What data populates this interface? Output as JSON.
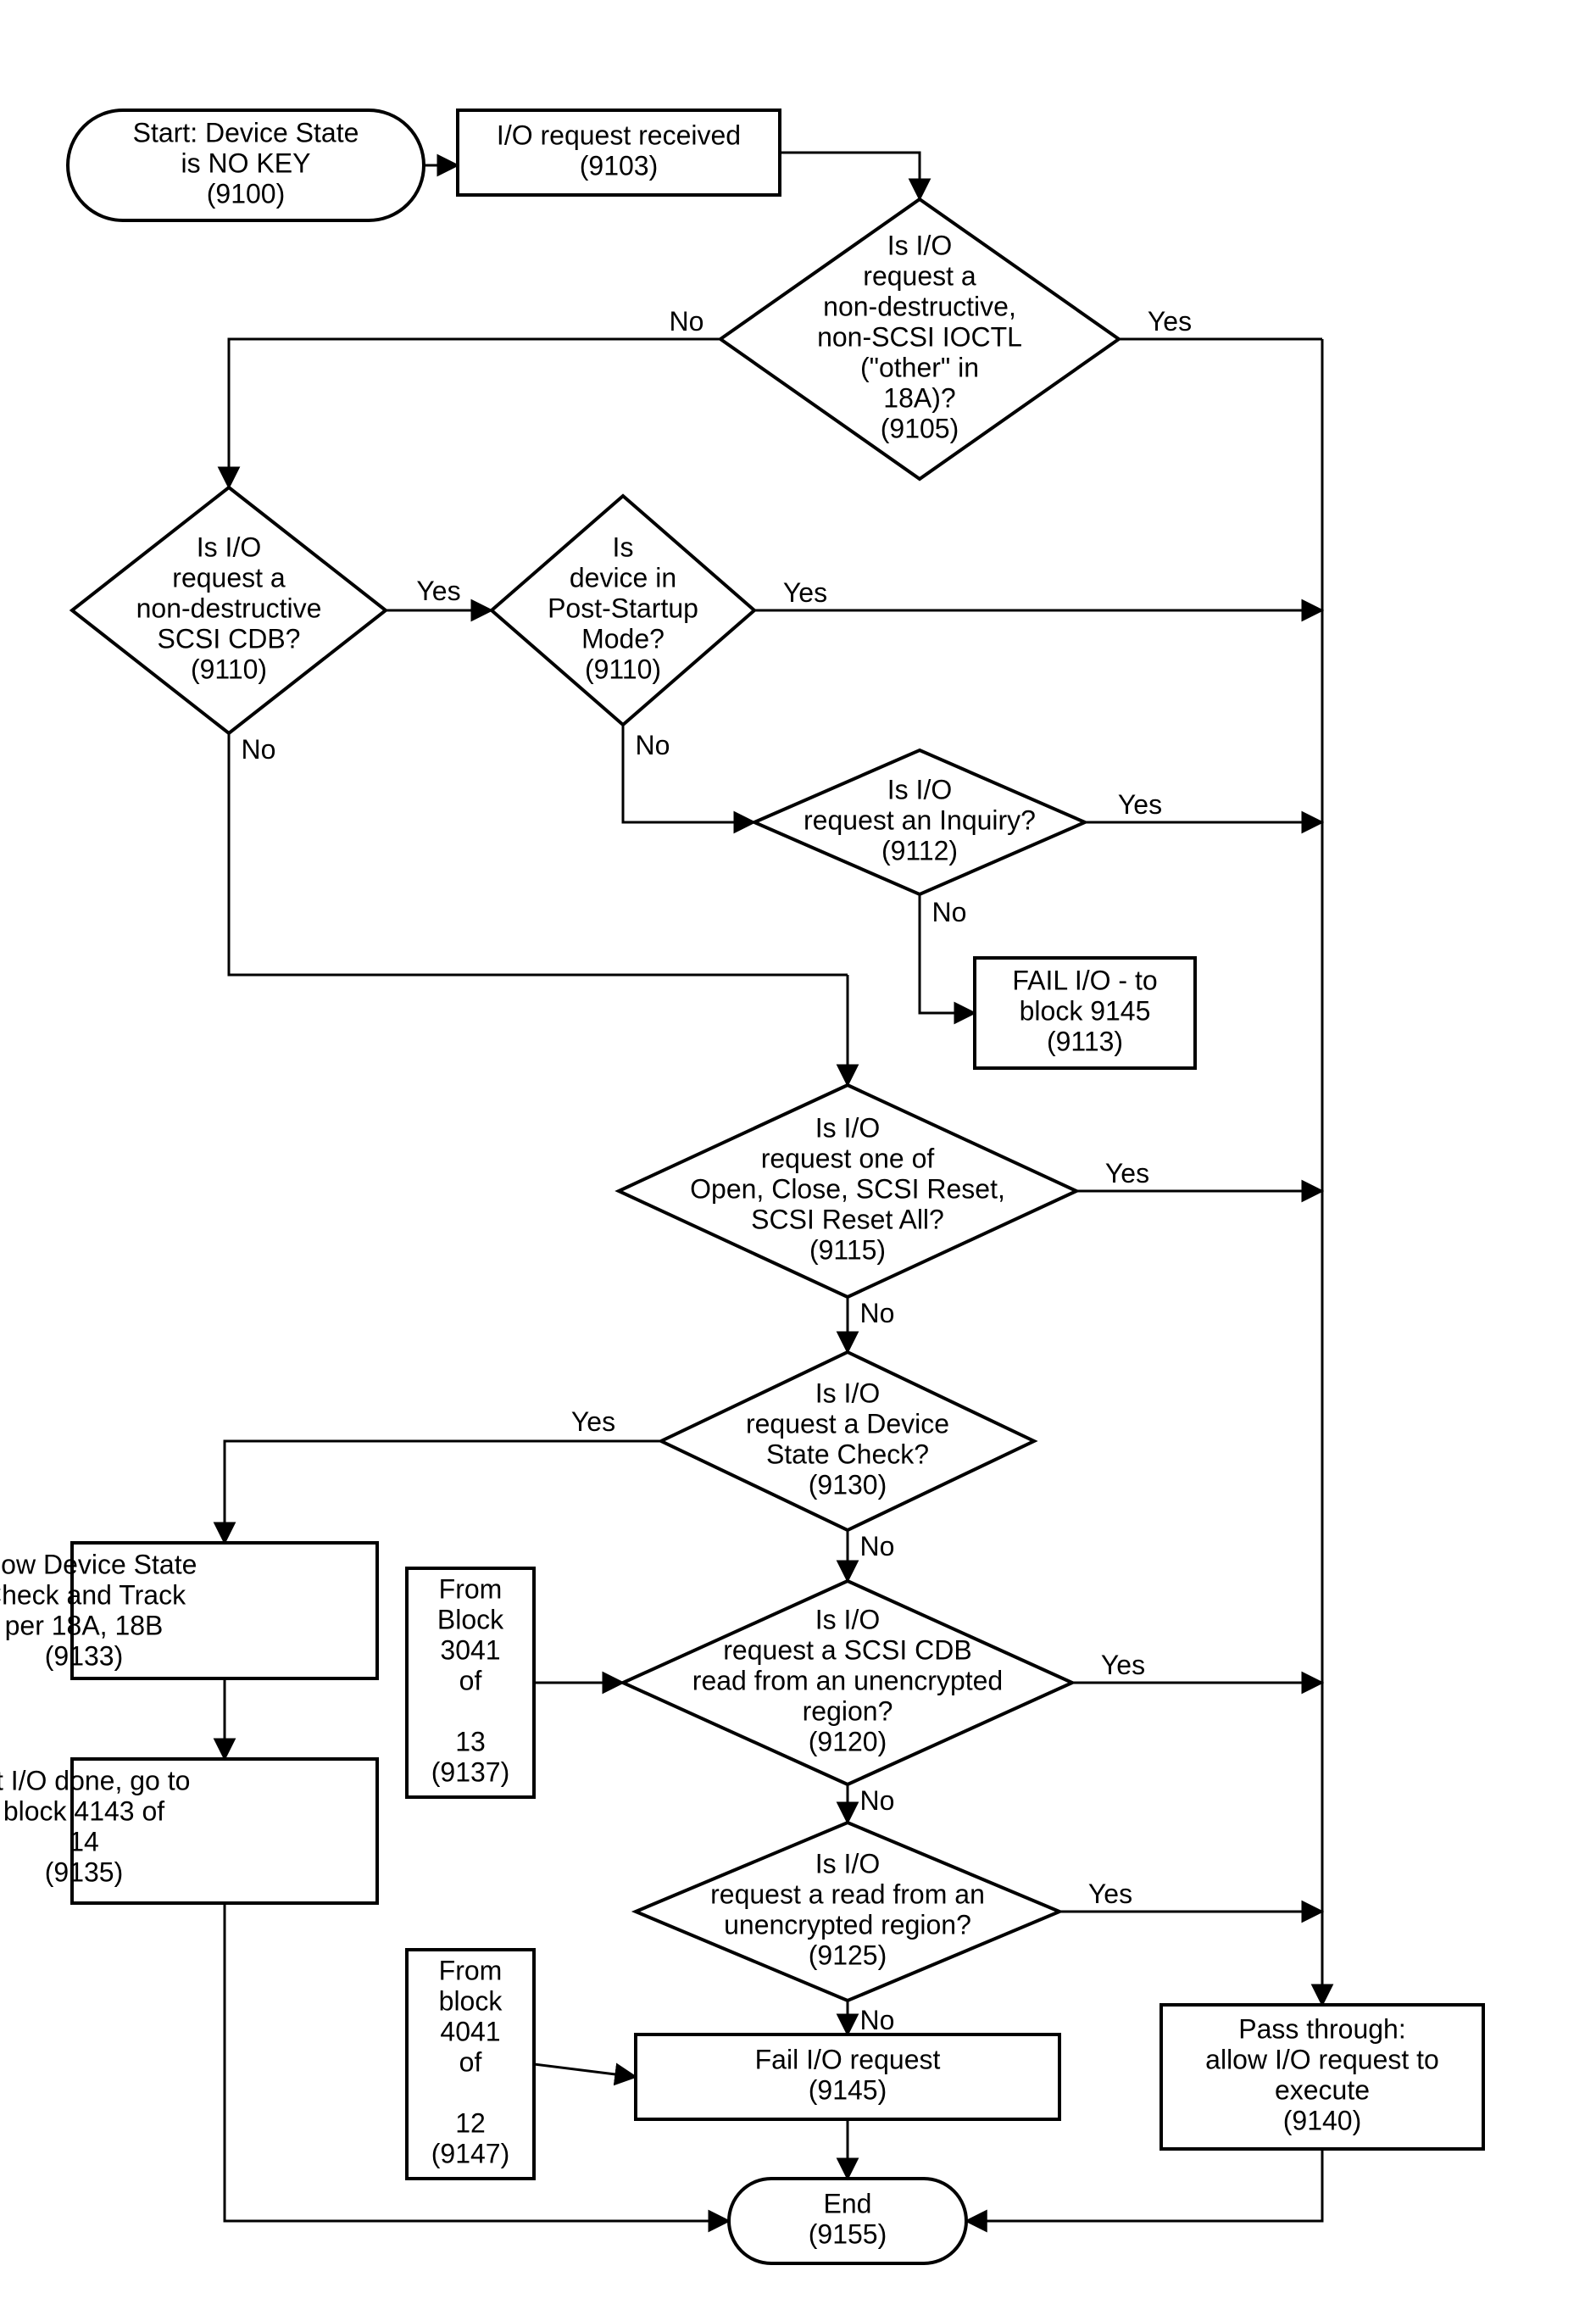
{
  "nodes": {
    "start": {
      "lines": [
        "Start:  Device State",
        "is NO KEY",
        "(9100)"
      ]
    },
    "n9103": {
      "lines": [
        "I/O request received",
        "(9103)"
      ]
    },
    "n9105": {
      "lines": [
        "Is I/O",
        "request a",
        "non-destructive,",
        "non-SCSI IOCTL",
        "(\"other\" in",
        "18A)?",
        "(9105)"
      ]
    },
    "n9110a": {
      "lines": [
        "Is I/O",
        "request a",
        "non-destructive",
        "SCSI CDB?",
        "(9110)"
      ]
    },
    "n9110b": {
      "lines": [
        "Is",
        "device in",
        "Post-Startup",
        "Mode?",
        "(9110)"
      ]
    },
    "n9112": {
      "lines": [
        "Is I/O",
        "request an Inquiry?",
        "(9112)"
      ]
    },
    "n9113": {
      "lines": [
        "FAIL I/O - to",
        "block 9145",
        "(9113)"
      ]
    },
    "n9115": {
      "lines": [
        "Is I/O",
        "request one of",
        "Open, Close, SCSI Reset,",
        "SCSI Reset All?",
        "(9115)"
      ]
    },
    "n9130": {
      "lines": [
        "Is I/O",
        "request a Device",
        "State Check?",
        "(9130)"
      ]
    },
    "n9133": {
      "lines": [
        "Allow Device State",
        "Check and Track",
        "per        18A, 18B",
        "(9133)"
      ]
    },
    "n9137": {
      "lines": [
        "From",
        "Block",
        "3041",
        "of",
        "",
        "13",
        "(9137)"
      ]
    },
    "n9120": {
      "lines": [
        "Is I/O",
        "request a SCSI CDB",
        "read from an unencrypted",
        "region?",
        "(9120)"
      ]
    },
    "n9135": {
      "lines": [
        "At I/O done, go to",
        "block 4143 of",
        "14",
        "(9135)"
      ]
    },
    "n9125": {
      "lines": [
        "Is I/O",
        "request a read from an",
        "unencrypted region?",
        "(9125)"
      ]
    },
    "n9147": {
      "lines": [
        "From",
        "block",
        "4041",
        "of",
        "",
        "12",
        "(9147)"
      ]
    },
    "n9145": {
      "lines": [
        "Fail I/O request",
        "(9145)"
      ]
    },
    "n9140": {
      "lines": [
        "Pass through:",
        "allow I/O request to",
        "execute",
        "(9140)"
      ]
    },
    "end": {
      "lines": [
        "End",
        "(9155)"
      ]
    }
  },
  "labels": {
    "yes": "Yes",
    "no": "No"
  }
}
